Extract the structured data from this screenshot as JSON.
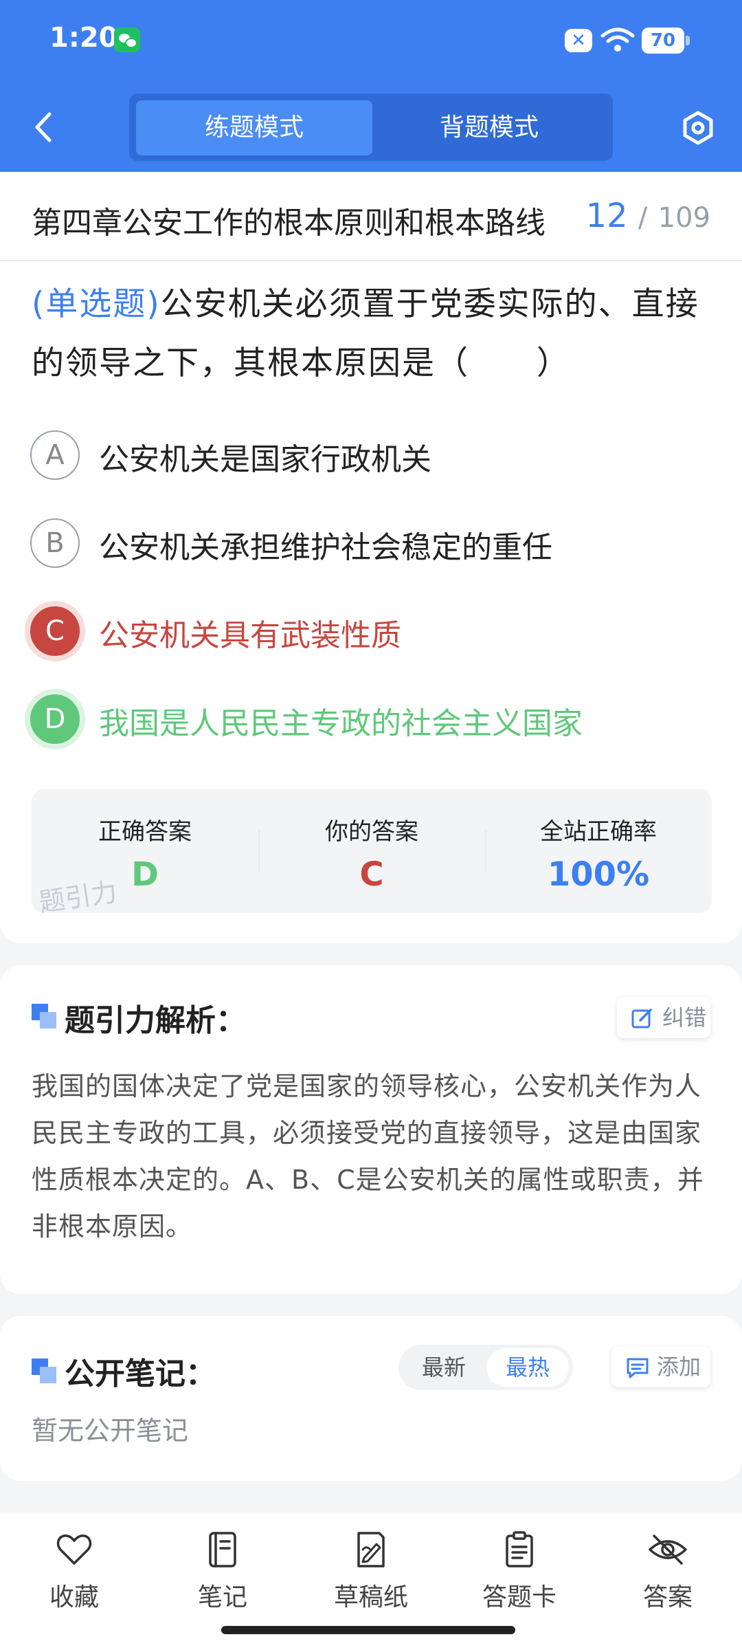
{
  "status_bar": {
    "time": "1:20",
    "battery": "70",
    "mute_symbol": "✕"
  },
  "header": {
    "mode_tabs": [
      {
        "label": "练题模式",
        "active": true
      },
      {
        "label": "背题模式",
        "active": false
      }
    ]
  },
  "question": {
    "chapter_title": "第四章公安工作的根本原则和根本路线",
    "current_index": "12",
    "separator": "/",
    "total": "109",
    "type_label": "(单选题)",
    "stem": "公安机关必须置于党委实际的、直接的领导之下，其根本原因是（　　）",
    "options": [
      {
        "letter": "A",
        "text": "公安机关是国家行政机关",
        "state": "normal"
      },
      {
        "letter": "B",
        "text": "公安机关承担维护社会稳定的重任",
        "state": "normal"
      },
      {
        "letter": "C",
        "text": "公安机关具有武装性质",
        "state": "wrong"
      },
      {
        "letter": "D",
        "text": "我国是人民民主专政的社会主义国家",
        "state": "right"
      }
    ]
  },
  "answer_summary": {
    "correct_label": "正确答案",
    "correct_value": "D",
    "yours_label": "你的答案",
    "yours_value": "C",
    "rate_label": "全站正确率",
    "rate_value": "100%",
    "watermark": "题引力"
  },
  "analysis": {
    "title": "题引力解析：",
    "report_button": "纠错",
    "text": "我国的国体决定了党是国家的领导核心，公安机关作为人民民主专政的工具，必须接受党的直接领导，这是由国家性质根本决定的。A、B、C是公安机关的属性或职责，并非根本原因。"
  },
  "notes": {
    "title": "公开笔记：",
    "sort_latest": "最新",
    "sort_hot": "最热",
    "add_button": "添加",
    "empty_text": "暂无公开笔记"
  },
  "bottom_nav": [
    {
      "label": "收藏",
      "icon": "heart-icon"
    },
    {
      "label": "笔记",
      "icon": "notebook-icon"
    },
    {
      "label": "草稿纸",
      "icon": "draft-icon"
    },
    {
      "label": "答题卡",
      "icon": "answer-card-icon"
    },
    {
      "label": "答案",
      "icon": "eye-off-icon"
    }
  ],
  "colors": {
    "primary": "#3d7ff0",
    "wrong": "#c7463f",
    "right": "#5fc87a"
  }
}
